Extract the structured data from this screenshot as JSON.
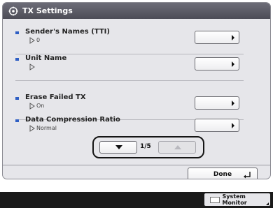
{
  "window": {
    "title": "TX Settings",
    "title_icon": "gear-icon"
  },
  "settings": [
    {
      "label": "Sender's Names (TTI)",
      "value": "0"
    },
    {
      "label": "Unit Name",
      "value": ""
    },
    {
      "label": "Erase Failed TX",
      "value": "On"
    },
    {
      "label": "Data Compression Ratio",
      "value": "Normal"
    }
  ],
  "pager": {
    "indicator": "1/5",
    "down_icon": "down-triangle-icon",
    "up_icon": "up-triangle-icon",
    "up_enabled": false
  },
  "footer": {
    "done_label": "Done",
    "done_icon": "return-arrow-icon"
  },
  "status_bar": {
    "system_monitor_label": "System Monitor"
  },
  "colors": {
    "accent": "#2f5fc4",
    "titlebar": "#55555f"
  }
}
